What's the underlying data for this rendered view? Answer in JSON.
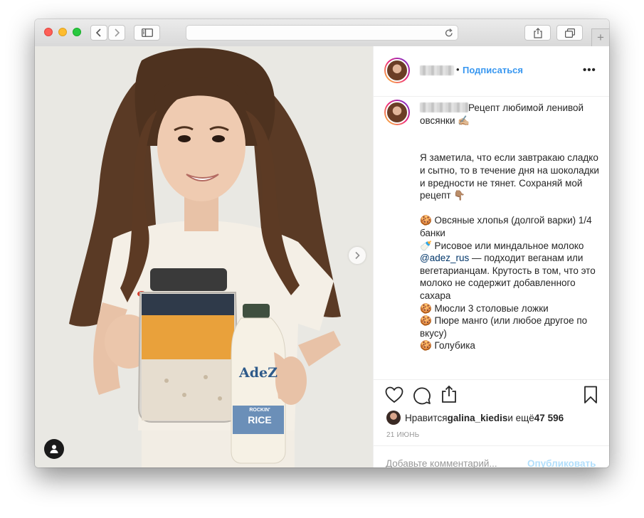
{
  "browser": {
    "traffic_lights": {
      "close": "#fe5f57",
      "minimize": "#febc2e",
      "zoom": "#28c840"
    },
    "url": "",
    "new_tab_label": "+"
  },
  "post": {
    "username_hidden": true,
    "separator": "•",
    "follow_label": "Подписаться",
    "more_label": "•••",
    "caption": {
      "title_line1": "Рецепт любимой ленивой",
      "title_line2": "овсянки ✍🏼",
      "paragraph1": "Я заметила, что если завтракаю сладко и сытно, то в течение дня на шоколадки и вредности не тянет. Сохраняй мой рецепт 👇🏽",
      "item1": "🍪 Овсяные хлопья (долгой варки) 1/4 банки",
      "item2_prefix": "🍼 Рисовое или миндальное молоко ",
      "item2_mention": "@adez_rus",
      "item2_suffix": " — подходит веганам или вегетарианцам. Крутость в том, что это молоко не содержит добавленного сахара",
      "item3": "🍪 Мюсли 3 столовые ложки",
      "item4": "🍪 Пюре манго (или любое другое по вкусу)",
      "item5": "🍪 Голубика"
    },
    "likes": {
      "prefix": "Нравится ",
      "user": "galina_kiedis",
      "middle": " и ещё ",
      "count": "47 596"
    },
    "date": "21 ИЮНЬ",
    "comment_placeholder": "Добавьте комментарий...",
    "publish_label": "Опубликовать"
  },
  "photo": {
    "bottle_brand": "AdeZ",
    "bottle_variant_1": "ROCKIN'",
    "bottle_variant_2": "RICE"
  },
  "colors": {
    "accent_blue": "#3897f0",
    "publish_disabled": "#b2dffc",
    "text": "#262626",
    "muted": "#999999"
  }
}
